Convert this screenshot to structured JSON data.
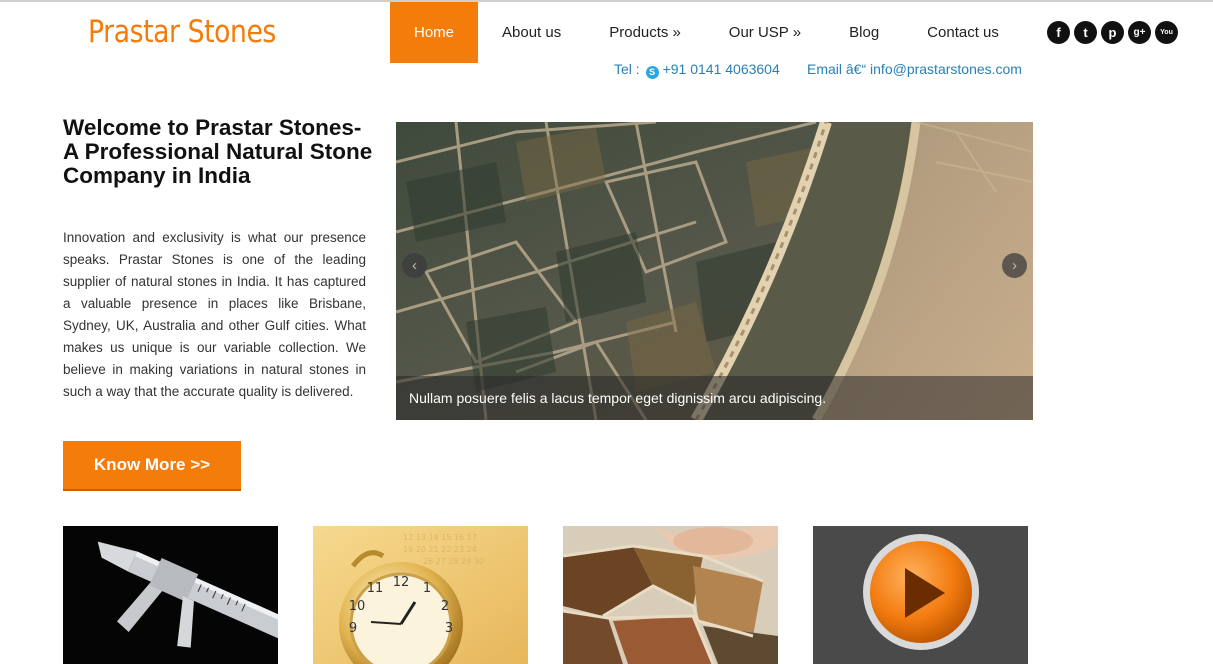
{
  "brand": {
    "name": "Prastar Stones",
    "accent": "#f47c0b"
  },
  "nav": [
    {
      "label": "Home",
      "active": true
    },
    {
      "label": "About us"
    },
    {
      "label": "Products",
      "arrow": "»"
    },
    {
      "label": "Our USP",
      "arrow": "»"
    },
    {
      "label": "Blog"
    },
    {
      "label": "Contact us"
    }
  ],
  "social": [
    {
      "icon": "facebook-icon",
      "glyph": "f"
    },
    {
      "icon": "twitter-icon",
      "glyph": "t"
    },
    {
      "icon": "pinterest-icon",
      "glyph": "p"
    },
    {
      "icon": "google-plus-icon",
      "glyph": "g+"
    },
    {
      "icon": "youtube-icon",
      "glyph": "You"
    }
  ],
  "contact": {
    "tel_label": "Tel :",
    "tel_value": "+91 0141 4063604",
    "email_label": "Email â€“",
    "email_value": "info@prastarstones.com"
  },
  "welcome": {
    "title": "Welcome to Prastar Stones- A Professional Natural Stone Company in India",
    "body": "Innovation and exclusivity is what our presence speaks. Prastar Stones is one of the leading supplier of natural stones in India. It has captured a valuable presence in places like Brisbane, Sydney, UK, Australia and other Gulf cities. What makes us unique is our variable collection. We believe in making variations in natural stones in such a way that the accurate quality is delivered.",
    "button": "Know More >>"
  },
  "slider": {
    "caption": "Nullam posuere felis a lacus tempor eget dignissim arcu adipiscing.",
    "prev": "‹",
    "next": "›"
  },
  "thumbnails": [
    {
      "icon": "caliper-icon"
    },
    {
      "icon": "pocket-watch-icon"
    },
    {
      "icon": "stone-mosaic-icon"
    },
    {
      "icon": "play-video-icon"
    }
  ]
}
